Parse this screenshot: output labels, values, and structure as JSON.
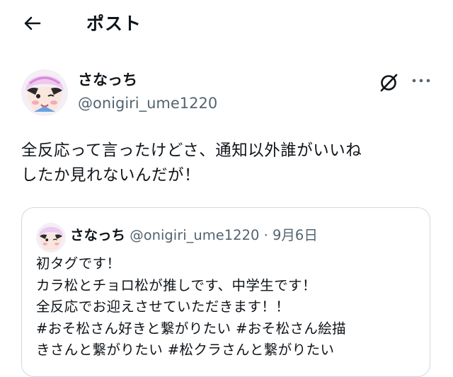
{
  "header": {
    "title": "ポスト",
    "back_icon": "arrow-left-icon"
  },
  "post": {
    "display_name": "さなっち",
    "handle": "@onigiri_ume1220",
    "text_lines": [
      "全反応って言ったけどさ、通知以外誰がいいね",
      "したか見れないんだが！"
    ],
    "grok_icon": "grok-icon",
    "more_icon": "more-dots-icon"
  },
  "quote": {
    "display_name": "さなっち",
    "handle": "@onigiri_ume1220",
    "separator": "·",
    "date": "9月6日",
    "lines": [
      "初タグです！",
      "カラ松とチョロ松が推しです、中学生です！",
      "全反応でお迎えさせていただきます！！",
      "#おそ松さん好きと繋がりたい #おそ松さん絵描",
      "きさんと繋がりたい #松クラさんと繋がりたい"
    ]
  }
}
